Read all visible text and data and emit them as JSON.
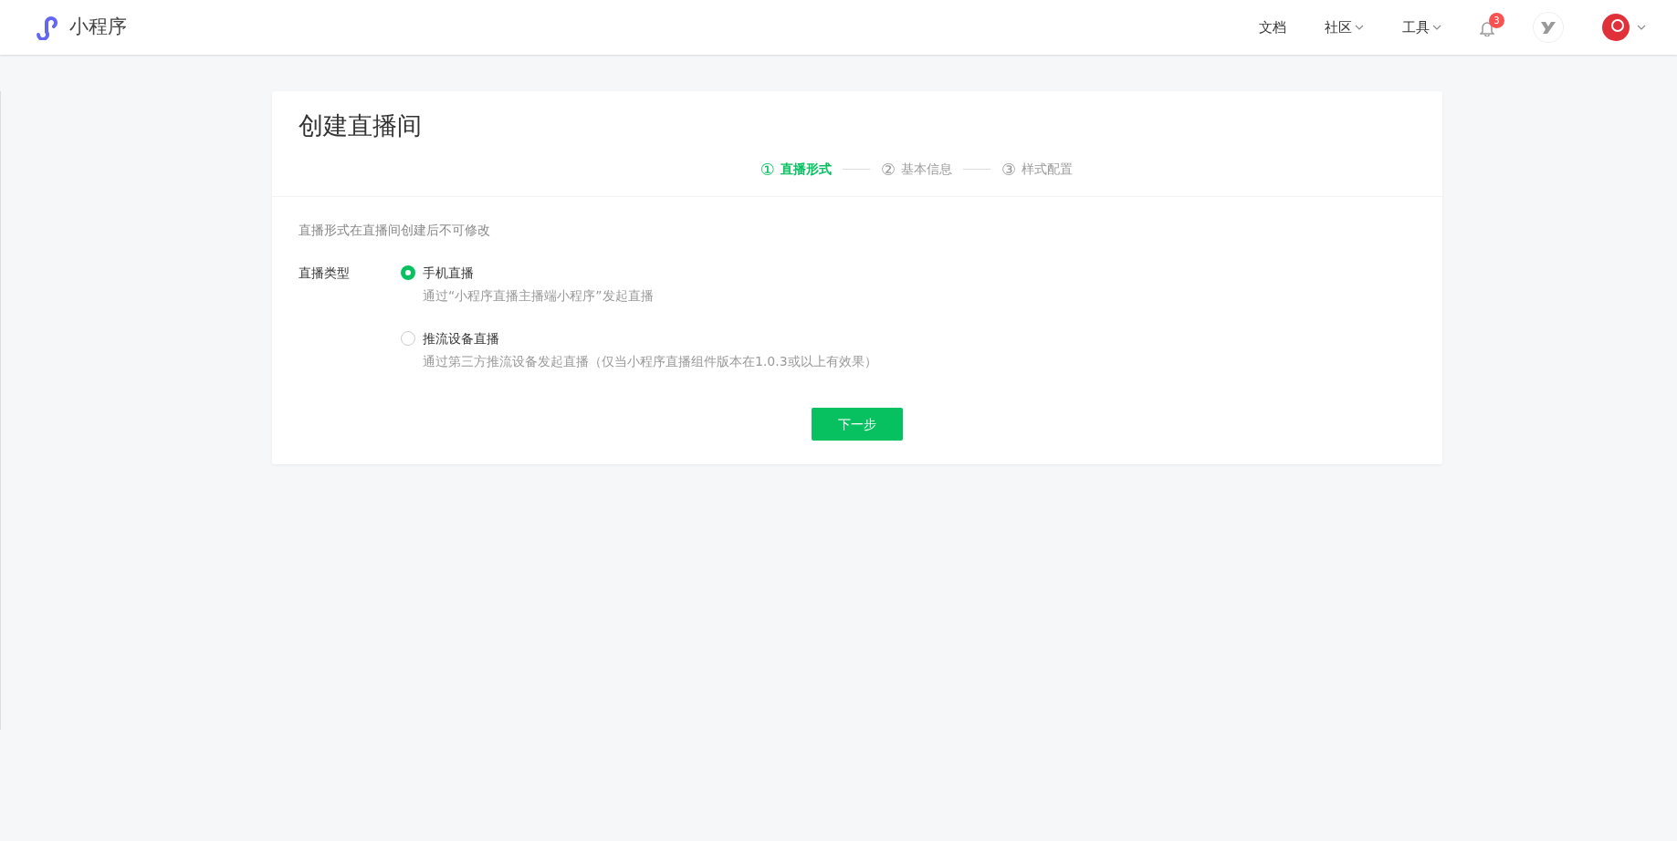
{
  "header": {
    "brand": "小程序",
    "nav": [
      {
        "label": "文档",
        "dropdown": false
      },
      {
        "label": "社区",
        "dropdown": true
      },
      {
        "label": "工具",
        "dropdown": true
      }
    ],
    "notifications": {
      "count": "3"
    }
  },
  "page": {
    "title": "创建直播间",
    "steps": [
      {
        "number": "①",
        "label": "直播形式",
        "selected": true
      },
      {
        "number": "②",
        "label": "基本信息",
        "selected": false
      },
      {
        "number": "③",
        "label": "样式配置",
        "selected": false
      }
    ],
    "note": "直播形式在直播间创建后不可修改",
    "field_label": "直播类型",
    "options": [
      {
        "label": "手机直播",
        "description": "通过“小程序直播主播端小程序”发起直播",
        "selected": true
      },
      {
        "label": "推流设备直播",
        "description": "通过第三方推流设备发起直播（仅当小程序直播组件版本在1.0.3或以上有效果）",
        "selected": false
      }
    ],
    "next_button": "下一步"
  }
}
